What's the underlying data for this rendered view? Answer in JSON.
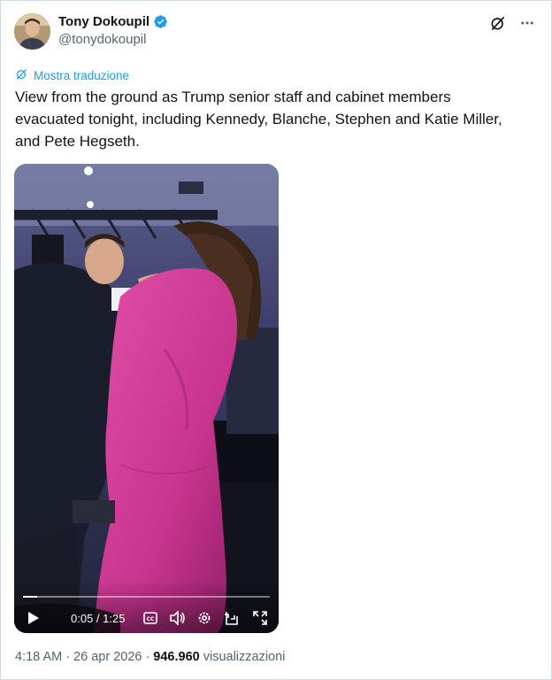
{
  "author": {
    "display_name": "Tony Dokoupil",
    "handle": "@tonydokoupil",
    "verified": true,
    "verified_color": "#1d9bf0"
  },
  "actions": {
    "grok_icon": "grok-icon",
    "more_icon": "more-icon"
  },
  "translate_label": "Mostra traduzione",
  "tweet_text": "View from the ground as Trump senior staff and cabinet members evacuated tonight, including Kennedy, Blanche, Stephen and Katie Miller, and Pete Hegseth.",
  "video": {
    "time_display": "0:05 / 1:25",
    "current_seconds": 5,
    "total_seconds": 85
  },
  "meta": {
    "time": "4:18 AM",
    "separator": "·",
    "date": "26 apr 2026",
    "views_count": "946.960",
    "views_label": "visualizzazioni"
  },
  "colors": {
    "accent": "#1d9bf0",
    "text": "#0f1419",
    "secondary": "#536471"
  }
}
